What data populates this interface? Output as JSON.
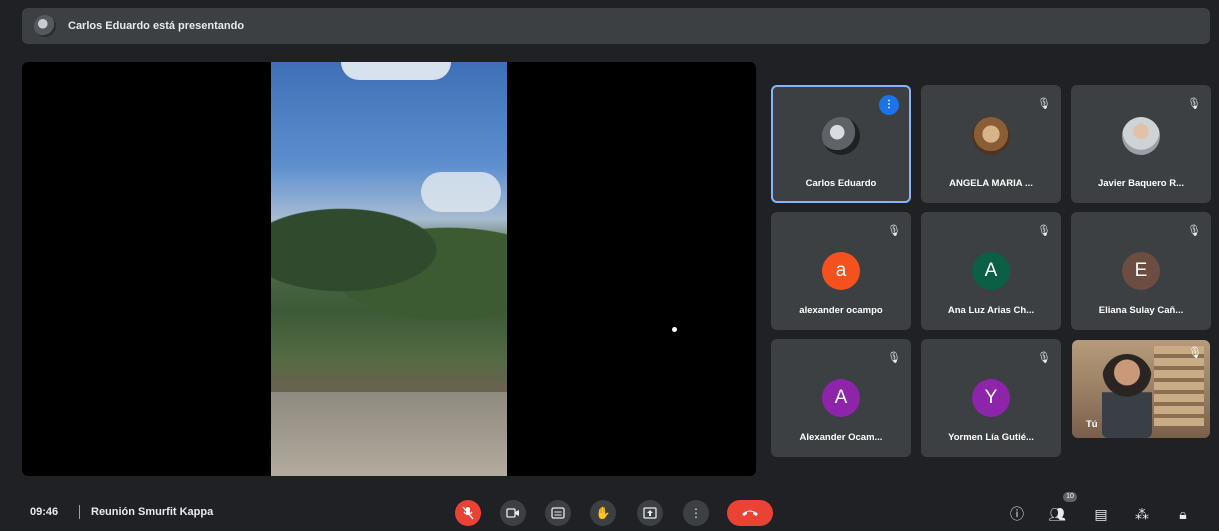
{
  "banner": {
    "presenting_text": "Carlos Eduardo está presentando"
  },
  "participants": [
    {
      "name": "Carlos Eduardo",
      "type": "photo",
      "speaking": true
    },
    {
      "name": "ANGELA MARIA ...",
      "type": "photo",
      "muted": true
    },
    {
      "name": "Javier Baquero R...",
      "type": "photo",
      "muted": true
    },
    {
      "name": "alexander ocampo",
      "initial": "a",
      "color": "#f4511e",
      "muted": true
    },
    {
      "name": "Ana Luz Arias Ch...",
      "initial": "A",
      "color": "#0b5f44",
      "muted": true
    },
    {
      "name": "Eliana Sulay Cañ...",
      "initial": "E",
      "color": "#6d4c41",
      "muted": true
    },
    {
      "name": "Alexander Ocam...",
      "initial": "A",
      "color": "#8e24aa",
      "muted": true
    },
    {
      "name": "Yormen Lía Gutié...",
      "initial": "Y",
      "color": "#8e24aa",
      "muted": true
    },
    {
      "name": "Tú",
      "type": "video",
      "muted": true
    }
  ],
  "bottombar": {
    "time": "09:46",
    "meeting_name": "Reunión Smurfit Kappa",
    "people_count": "10",
    "controls": [
      "mic-off-icon",
      "camera-icon",
      "captions-icon",
      "raise-hand-icon",
      "present-icon",
      "more-options-icon",
      "end-call-icon"
    ],
    "right_controls": [
      "info-icon",
      "people-icon",
      "chat-icon",
      "activities-icon",
      "host-controls-icon"
    ]
  },
  "colors": {
    "accent": "#8ab4f8",
    "danger": "#ea4335",
    "surface": "#3c4043",
    "background": "#202124"
  }
}
